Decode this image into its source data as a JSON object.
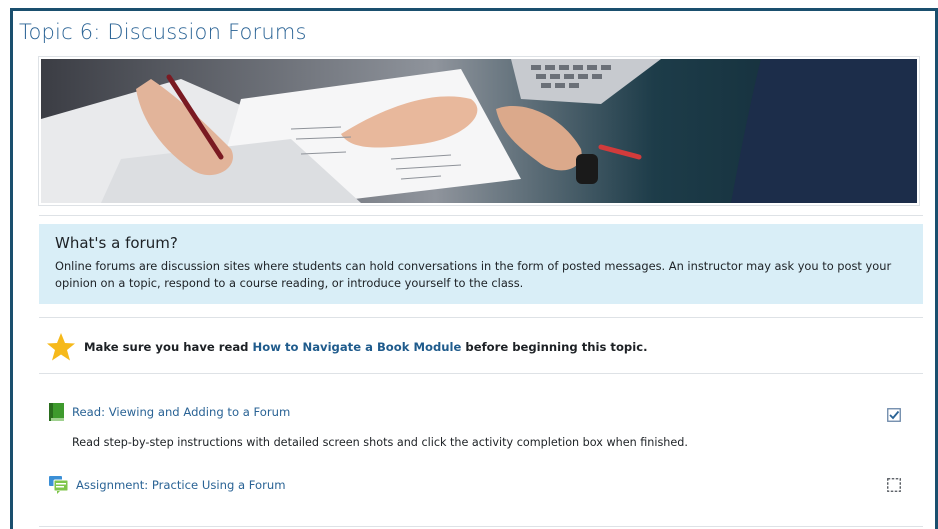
{
  "topic": {
    "title": "Topic 6: Discussion Forums"
  },
  "info": {
    "heading": "What's a forum?",
    "text": "Online forums are discussion sites where students can hold conversations in the form of posted messages. An instructor may ask you to post your opinion on a topic, respond to a course reading, or introduce yourself to the class."
  },
  "notice": {
    "prefix": "Make sure you have read ",
    "link": "How to Navigate a Book Module",
    "suffix": " before beginning this topic."
  },
  "activities": [
    {
      "icon": "book-icon",
      "label": "Read: Viewing and Adding to a Forum",
      "description": "Read step-by-step instructions with detailed screen shots and click the activity completion box when finished.",
      "completed": true
    },
    {
      "icon": "forum-icon",
      "label": "Assignment: Practice Using a Forum",
      "completed": false
    }
  ],
  "colors": {
    "frame": "#1a4f6e",
    "title": "#2a6395",
    "info_bg": "#d9eef7",
    "link": "#2a6395"
  }
}
